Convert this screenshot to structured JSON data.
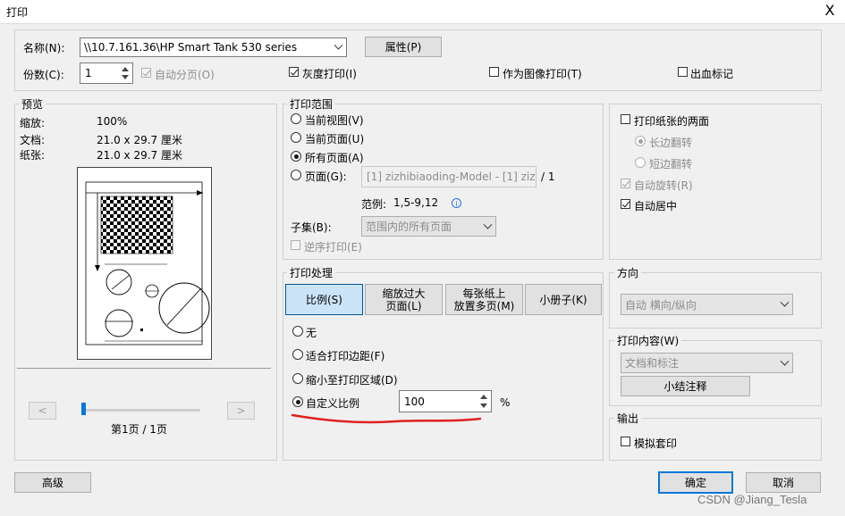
{
  "window": {
    "title": "打印",
    "close_glyph": "X"
  },
  "printer": {
    "name_label": "名称(N):",
    "name_value": "\\\\10.7.161.36\\HP Smart Tank 530 series",
    "properties_button": "属性(P)",
    "copies_label": "份数(C):",
    "copies_value": "1",
    "collate_label": "自动分页(O)",
    "grayscale_label": "灰度打印(I)",
    "as_image_label": "作为图像打印(T)",
    "bleed_label": "出血标记"
  },
  "preview": {
    "group_label": "预览",
    "zoom_label": "缩放:",
    "zoom_value": "100%",
    "document_label": "文档:",
    "document_value": "21.0 x 29.7 厘米",
    "paper_label": "纸张:",
    "paper_value": "21.0 x 29.7 厘米",
    "prev_glyph": "<",
    "next_glyph": ">",
    "page_indicator": "第1页 / 1页"
  },
  "print_range": {
    "group_label": "打印范围",
    "current_view": "当前视图(V)",
    "current_page": "当前页面(U)",
    "all_pages": "所有页面(A)",
    "pages_label": "页面(G):",
    "pages_value": "[1] zizhibiaoding-Model - [1] zizhibi",
    "pages_total": "/ 1",
    "example_label": "范例:",
    "example_value": "1,5-9,12",
    "subset_label": "子集(B):",
    "subset_value": "范围内的所有页面",
    "reverse_label": "逆序打印(E)"
  },
  "handling": {
    "group_label": "打印处理",
    "tab_scale": "比例(S)",
    "tab_oversize": [
      "缩放过大",
      "页面(L)"
    ],
    "tab_multiple": [
      "每张纸上",
      "放置多页(M)"
    ],
    "tab_booklet": "小册子(K)",
    "opt_none": "无",
    "opt_fit_margins": "适合打印边距(F)",
    "opt_shrink": "缩小至打印区域(D)",
    "opt_custom": "自定义比例",
    "custom_value": "100",
    "custom_unit": "%"
  },
  "duplex": {
    "both_sides": "打印纸张的两面",
    "long_edge": "长边翻转",
    "short_edge": "短边翻转",
    "auto_rotate": "自动旋转(R)",
    "auto_center": "自动居中"
  },
  "orientation": {
    "group_label": "方向",
    "value": "自动 横向/纵向"
  },
  "content": {
    "group_label": "打印内容(W)",
    "value": "文档和标注",
    "summarize_button": "小结注释"
  },
  "output": {
    "group_label": "输出",
    "simulate_overprint": "模拟套印"
  },
  "footer": {
    "advanced_button": "高级",
    "ok_button": "确定",
    "cancel_button": "取消",
    "watermark": "CSDN @Jiang_Tesla"
  },
  "colors": {
    "accent": "#0078d7",
    "annotation": "#e02020"
  }
}
